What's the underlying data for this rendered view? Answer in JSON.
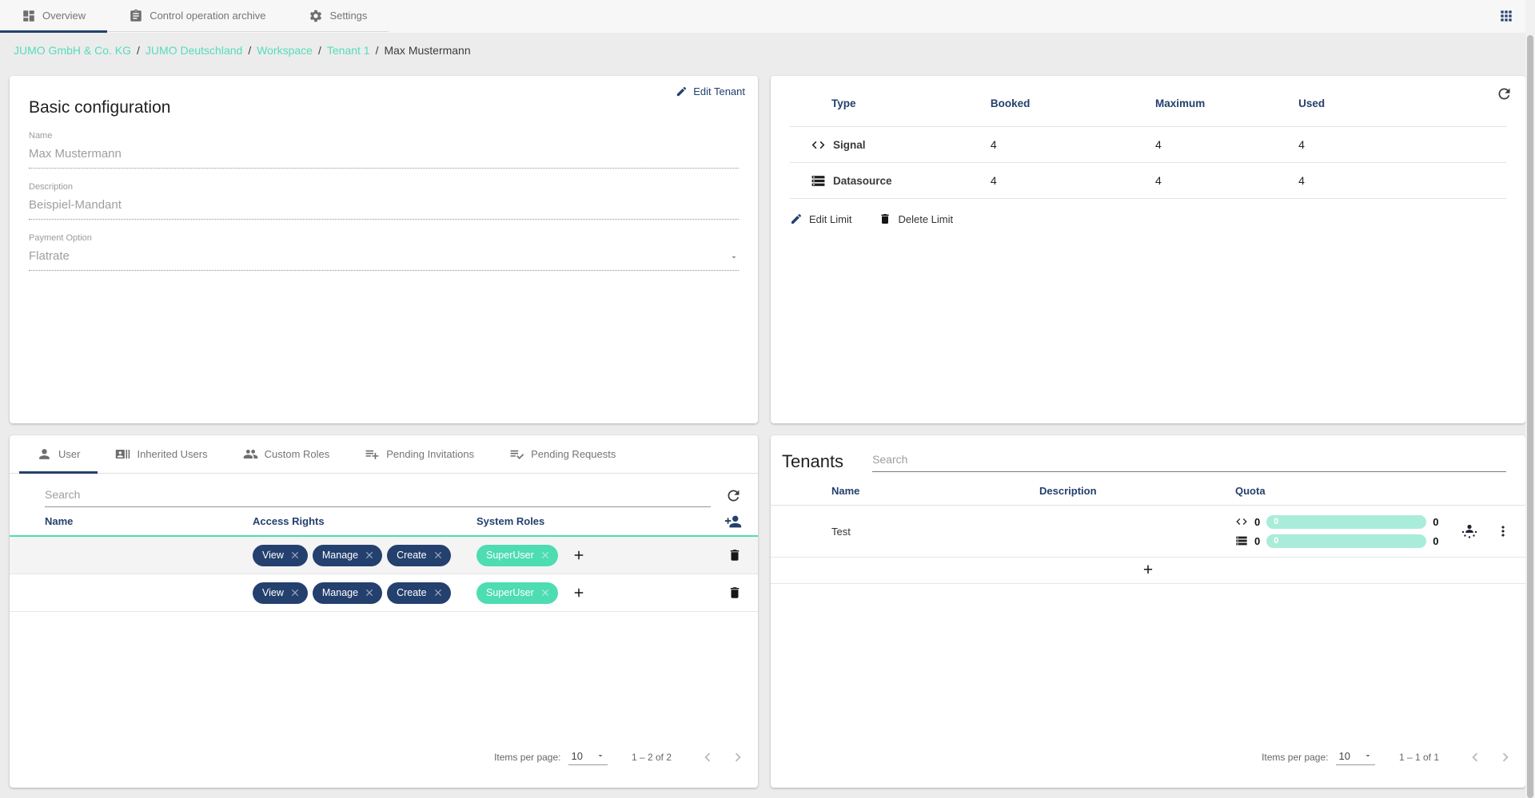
{
  "topbar": {
    "tabs": [
      {
        "label": "Overview",
        "icon": "dashboard-icon",
        "active": true
      },
      {
        "label": "Control operation archive",
        "icon": "clipboard-icon",
        "active": false
      },
      {
        "label": "Settings",
        "icon": "gear-icon",
        "active": false
      }
    ],
    "apps_icon": "apps-grid-icon"
  },
  "breadcrumb": {
    "separator": "/",
    "items": [
      {
        "label": "JUMO GmbH & Co. KG",
        "type": "link"
      },
      {
        "label": "JUMO Deutschland",
        "type": "link"
      },
      {
        "label": "Workspace",
        "type": "link"
      },
      {
        "label": "Tenant 1",
        "type": "link"
      },
      {
        "label": "Max Mustermann",
        "type": "current"
      }
    ]
  },
  "basic_config": {
    "title": "Basic configuration",
    "edit_button": "Edit Tenant",
    "fields": {
      "name": {
        "label": "Name",
        "value": "Max Mustermann"
      },
      "description": {
        "label": "Description",
        "value": "Beispiel-Mandant"
      },
      "payment": {
        "label": "Payment Option",
        "value": "Flatrate"
      }
    }
  },
  "limits": {
    "columns": {
      "type": "Type",
      "booked": "Booked",
      "maximum": "Maximum",
      "used": "Used"
    },
    "rows": [
      {
        "type": "Signal",
        "icon": "code-icon",
        "booked": "4",
        "maximum": "4",
        "used": "4"
      },
      {
        "type": "Datasource",
        "icon": "storage-icon",
        "booked": "4",
        "maximum": "4",
        "used": "4"
      }
    ],
    "edit_button": "Edit Limit",
    "delete_button": "Delete Limit"
  },
  "users": {
    "tabs": [
      {
        "label": "User",
        "icon": "person-icon",
        "active": true
      },
      {
        "label": "Inherited Users",
        "icon": "recent-actors-icon",
        "active": false
      },
      {
        "label": "Custom Roles",
        "icon": "people-icon",
        "active": false
      },
      {
        "label": "Pending Invitations",
        "icon": "playlist-add-icon",
        "active": false
      },
      {
        "label": "Pending Requests",
        "icon": "playlist-check-icon",
        "active": false
      }
    ],
    "search_placeholder": "Search",
    "columns": {
      "name": "Name",
      "access_rights": "Access Rights",
      "system_roles": "System Roles"
    },
    "rows": [
      {
        "name_blurred": true,
        "access_rights": [
          "View",
          "Manage",
          "Create"
        ],
        "system_roles": [
          "SuperUser"
        ]
      },
      {
        "name_blurred": true,
        "access_rights": [
          "View",
          "Manage",
          "Create"
        ],
        "system_roles": [
          "SuperUser"
        ]
      }
    ],
    "paginator": {
      "label": "Items per page:",
      "page_size": "10",
      "range": "1 – 2 of 2"
    }
  },
  "tenants": {
    "title": "Tenants",
    "search_placeholder": "Search",
    "columns": {
      "name": "Name",
      "description": "Description",
      "quota": "Quota"
    },
    "rows": [
      {
        "name": "Test",
        "description": "",
        "quota": [
          {
            "icon": "code-icon",
            "used": "0",
            "bar_label": "0",
            "max": "0"
          },
          {
            "icon": "storage-icon",
            "used": "0",
            "bar_label": "0",
            "max": "0"
          }
        ]
      }
    ],
    "add_button": "+",
    "paginator": {
      "label": "Items per page:",
      "page_size": "10",
      "range": "1 – 1 of 1"
    }
  },
  "colors": {
    "navy": "#24406e",
    "teal": "#4edcb2",
    "teal_light": "#a9ecd9"
  }
}
